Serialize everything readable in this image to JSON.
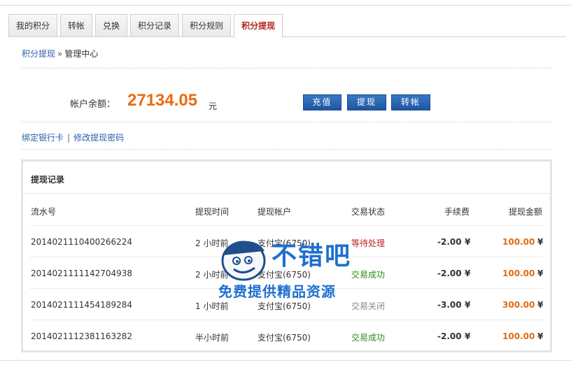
{
  "tabs": [
    {
      "label": "我的积分",
      "active": false
    },
    {
      "label": "转帐",
      "active": false
    },
    {
      "label": "兑换",
      "active": false
    },
    {
      "label": "积分记录",
      "active": false
    },
    {
      "label": "积分规则",
      "active": false
    },
    {
      "label": "积分提现",
      "active": true
    }
  ],
  "breadcrumb": {
    "link": "积分提现",
    "separator": "»",
    "current": "管理中心"
  },
  "balance": {
    "label": "帐户余额：",
    "value": "27134.05",
    "unit": "元"
  },
  "buttons": {
    "recharge": "充值",
    "withdraw": "提现",
    "transfer": "转帐"
  },
  "links": {
    "bind_card": "绑定银行卡",
    "divider": "|",
    "change_password": "修改提现密码"
  },
  "panel": {
    "title": "提现记录",
    "columns": [
      "流水号",
      "提现时间",
      "提现帐户",
      "交易状态",
      "手续费",
      "提现金额"
    ],
    "rows": [
      {
        "serial": "2014021110400266224",
        "time": "2 小时前",
        "account": "支付宝(6750)",
        "status": "等待处理",
        "status_color": "#c0221b",
        "fee": "-2.00",
        "amount": "100.00"
      },
      {
        "serial": "2014021111142704938",
        "time": "2 小时前",
        "account": "支付宝(6750)",
        "status": "交易成功",
        "status_color": "#2e8b1f",
        "fee": "-2.00",
        "amount": "100.00"
      },
      {
        "serial": "2014021111454189284",
        "time": "1 小时前",
        "account": "支付宝(6750)",
        "status": "交易关闭",
        "status_color": "#888888",
        "fee": "-3.00",
        "amount": "300.00"
      },
      {
        "serial": "2014021112381163282",
        "time": "半小时前",
        "account": "支付宝(6750)",
        "status": "交易成功",
        "status_color": "#2e8b1f",
        "fee": "-2.00",
        "amount": "100.00"
      }
    ],
    "currency": "¥"
  },
  "watermark": {
    "title": "不错吧",
    "subtitle": "免费提供精品资源"
  },
  "colors": {
    "accent": "#ec6a10",
    "link": "#2b5ea8",
    "button": "#1d56a0",
    "active_tab": "#b1261c"
  }
}
